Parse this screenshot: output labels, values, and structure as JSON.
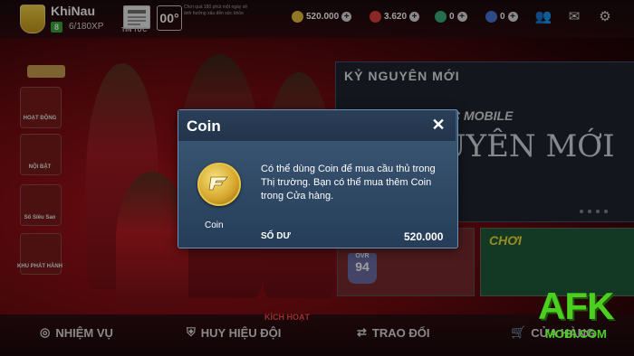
{
  "topbar": {
    "username": "KhiNau",
    "level": "8",
    "xp": "6/180XP",
    "news_label": "TIN TỨC",
    "temperature": "00°",
    "temp_note": "Chơi quá 180 phút một ngày sẽ ảnh hưởng xấu đến sức khỏe",
    "resources": [
      {
        "icon": "fc-points-icon",
        "value": "520.000",
        "color": "#e8c13a"
      },
      {
        "icon": "gem-icon",
        "value": "3.620",
        "color": "#e04040"
      },
      {
        "icon": "token-icon",
        "value": "0",
        "color": "#39b27c"
      },
      {
        "icon": "ticket-icon",
        "value": "0",
        "color": "#4a78d8"
      }
    ]
  },
  "side_menu": {
    "items": [
      {
        "label": "HOẠT ĐỘNG"
      },
      {
        "label": "NỘI BẬT"
      },
      {
        "label": "Số Siêu Sao"
      },
      {
        "label": "KHU PHÁT HÀNH"
      }
    ]
  },
  "right_panel": {
    "title": "KỶ NGUYÊN MỚI",
    "mobile_text": "C MOBILE",
    "big_text": "UYÊN MỚI",
    "ovr_label": "OVR",
    "ovr_value": "94",
    "play_label": "CHƠI"
  },
  "bottom_nav": {
    "tasks": "NHIỆM VỤ",
    "badges": "HUY HIỆU ĐỘI",
    "activate": "KÍCH HOẠT",
    "trade": "TRAO ĐỔI",
    "store": "CỬA HÀNG"
  },
  "watermark": {
    "main": "AFK",
    "sub": "MOBI.COM"
  },
  "dialog": {
    "title": "Coin",
    "close_symbol": "✕",
    "coin_label": "Coin",
    "description": "Có thể dùng Coin để mua cầu thủ trong Thị trường. Bạn có thể mua thêm Coin trong Cửa hàng.",
    "balance_label": "SỐ DƯ",
    "balance_value": "520.000"
  },
  "colors": {
    "accent_green": "#4cd01f",
    "dialog_bg": "#2e4866",
    "brand_red": "#b3141c"
  }
}
